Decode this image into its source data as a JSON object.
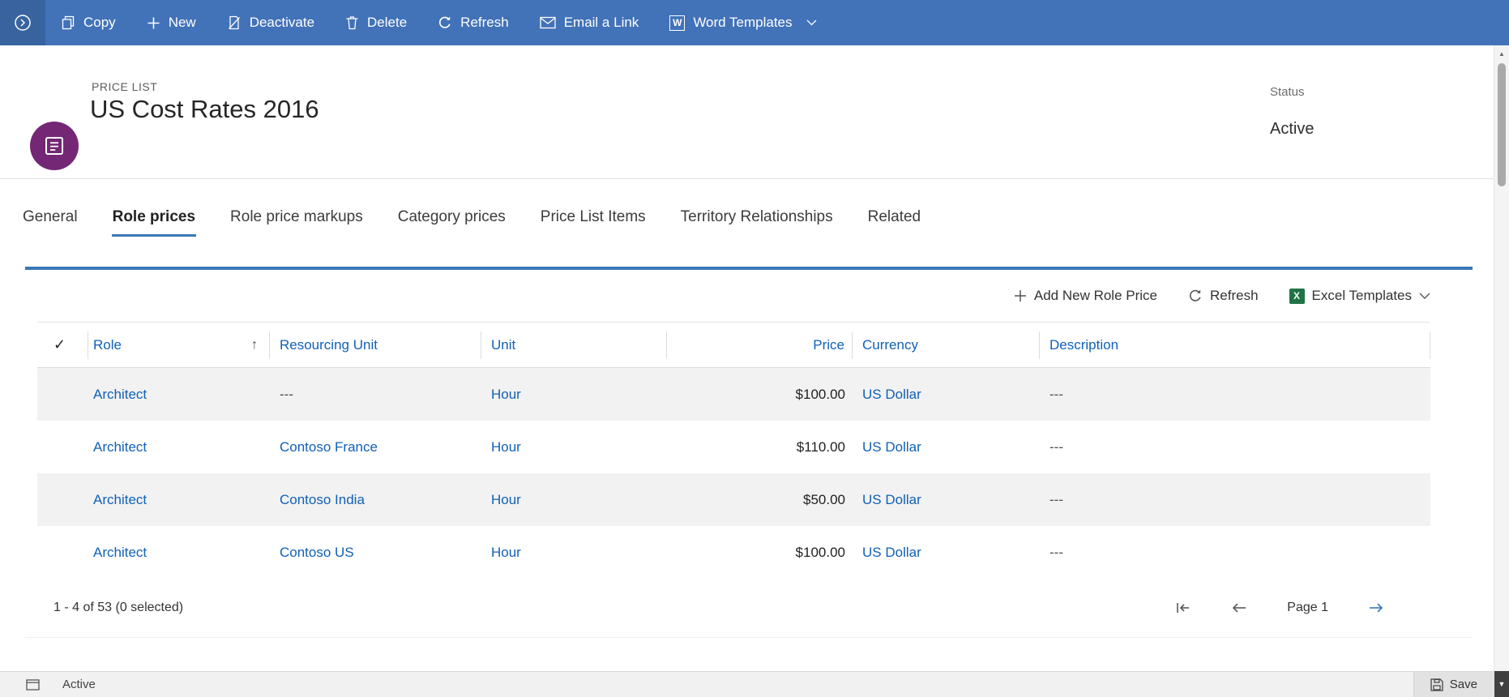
{
  "colors": {
    "command_bar_bg": "#4272B8",
    "command_bar_nav_bg": "#38639E",
    "accent_blue": "#3B79B7",
    "link_blue": "#1160B7",
    "entity_icon_bg": "#742774",
    "row_alt_bg": "#F2F2F2",
    "excel_green": "#217346",
    "status_bar_bg": "#F1F1F1"
  },
  "command_bar": {
    "items": [
      {
        "label": "Copy"
      },
      {
        "label": "New"
      },
      {
        "label": "Deactivate"
      },
      {
        "label": "Delete"
      },
      {
        "label": "Refresh"
      },
      {
        "label": "Email a Link"
      },
      {
        "label": "Word Templates",
        "has_dropdown": true
      }
    ]
  },
  "record_header": {
    "entity_label": "PRICE LIST",
    "title": "US Cost Rates 2016",
    "status_label": "Status",
    "status_value": "Active"
  },
  "tabs": [
    {
      "label": "General",
      "active": false
    },
    {
      "label": "Role prices",
      "active": true
    },
    {
      "label": "Role price markups",
      "active": false
    },
    {
      "label": "Category prices",
      "active": false
    },
    {
      "label": "Price List Items",
      "active": false
    },
    {
      "label": "Territory Relationships",
      "active": false
    },
    {
      "label": "Related",
      "active": false
    }
  ],
  "subgrid": {
    "toolbar": {
      "add_label": "Add New Role Price",
      "refresh_label": "Refresh",
      "excel_label": "Excel Templates"
    },
    "columns": [
      {
        "label": "Role",
        "sort": "ascending"
      },
      {
        "label": "Resourcing Unit"
      },
      {
        "label": "Unit"
      },
      {
        "label": "Price",
        "align": "right"
      },
      {
        "label": "Currency"
      },
      {
        "label": "Description"
      }
    ],
    "rows": [
      {
        "role": "Architect",
        "resourcing_unit": "---",
        "unit": "Hour",
        "price": "$100.00",
        "currency": "US Dollar",
        "description": "---"
      },
      {
        "role": "Architect",
        "resourcing_unit": "Contoso France",
        "unit": "Hour",
        "price": "$110.00",
        "currency": "US Dollar",
        "description": "---"
      },
      {
        "role": "Architect",
        "resourcing_unit": "Contoso India",
        "unit": "Hour",
        "price": "$50.00",
        "currency": "US Dollar",
        "description": "---"
      },
      {
        "role": "Architect",
        "resourcing_unit": "Contoso US",
        "unit": "Hour",
        "price": "$100.00",
        "currency": "US Dollar",
        "description": "---"
      }
    ],
    "footer": {
      "record_count": "1 - 4 of 53 (0 selected)",
      "page_label": "Page 1"
    }
  },
  "status_bar": {
    "form_state": "Active",
    "save_label": "Save"
  },
  "icons": {
    "check": "✓",
    "sort_ascending": "↑",
    "scroll_up": "▲",
    "scroll_down": "▼"
  }
}
